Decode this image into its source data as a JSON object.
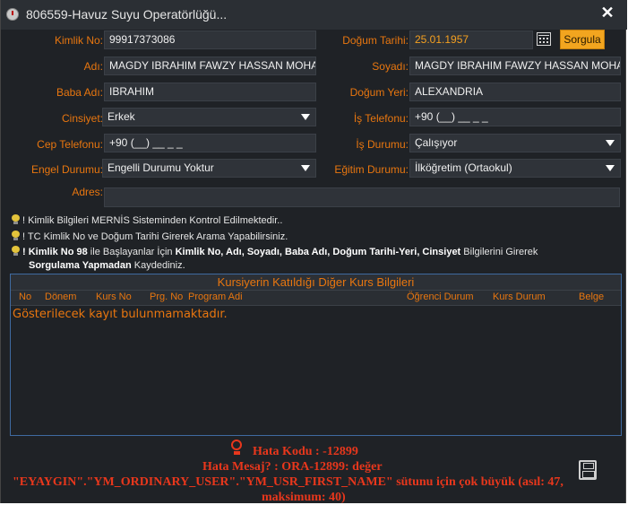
{
  "window": {
    "title": "806559-Havuz Suyu Operatörlüğü...",
    "close_glyph": "✕"
  },
  "form": {
    "kimlik_no": {
      "label": "Kimlik No:",
      "value": "99917373086"
    },
    "dogum_tarihi": {
      "label": "Doğum Tarihi:",
      "value": "25.01.1957"
    },
    "sorgula": "Sorgula",
    "adi": {
      "label": "Adı:",
      "value": "MAGDY IBRAHIM FAWZY HASSAN MOHAM"
    },
    "soyadi": {
      "label": "Soyadı:",
      "value": "MAGDY IBRAHIM FAWZY HASSAN MOHAM"
    },
    "baba_adi": {
      "label": "Baba Adı:",
      "value": "IBRAHIM"
    },
    "dogum_yeri": {
      "label": "Doğum Yeri:",
      "value": "ALEXANDRIA"
    },
    "cinsiyet": {
      "label": "Cinsiyet:",
      "value": "Erkek"
    },
    "is_telefonu": {
      "label": "İş Telefonu:",
      "value": "+90 (__) __ _ _"
    },
    "cep_telefonu": {
      "label": "Cep Telefonu:",
      "value": "+90 (__) __ _ _"
    },
    "is_durumu": {
      "label": "İş Durumu:",
      "value": "Çalışıyor"
    },
    "engel_durumu": {
      "label": "Engel Durumu:",
      "value": "Engelli Durumu Yoktur"
    },
    "egitim_durumu": {
      "label": "Eğitim Durumu:",
      "value": "İlköğretim (Ortaokul)"
    },
    "adres": {
      "label": "Adres:",
      "value": ""
    }
  },
  "info": {
    "line1": "! Kimlik Bilgileri MERNİS Sisteminden Kontrol Edilmektedir..",
    "line2": "! TC Kimlik No ve Doğum Tarihi Girerek Arama Yapabilirsiniz.",
    "line3": {
      "p1": "! Kimlik No 98",
      "p2": " ile Başlayanlar İçin ",
      "p3": "Kimlik No, Adı, Soyadı, Baba Adı, Doğum Tarihi-Yeri, Cinsiyet",
      "p4": " Bilgilerini Girerek",
      "p5": "Sorgulama Yapmadan",
      "p6": " Kaydediniz."
    }
  },
  "grid": {
    "title": "Kursiyerin Katıldığı Diğer Kurs Bilgileri",
    "columns": [
      "No",
      "Dönem",
      "Kurs No",
      "Prg. No",
      "Program Adi",
      "Öğrenci Durum",
      "Kurs Durum",
      "Belge"
    ],
    "empty_text": "Gösterilecek kayıt bulunmamaktadır."
  },
  "error": {
    "code": "Hata Kodu : -12899",
    "msg1": "Hata Mesaj? : ORA-12899: değer",
    "msg2": "\"EYAYGIN\".\"YM_ORDINARY_USER\".\"YM_USR_FIRST_NAME\" sütunu için çok büyük (asıl: 47,",
    "msg3": "maksimum: 40)"
  },
  "icons": [
    "info-bulb-icon",
    "calendar-icon",
    "error-bulb-icon",
    "save-icon",
    "close-icon",
    "app-icon"
  ],
  "colors": {
    "accent": "#e8760f",
    "button": "#f2a51f",
    "error": "#e8371c",
    "background": "#1f2226"
  }
}
